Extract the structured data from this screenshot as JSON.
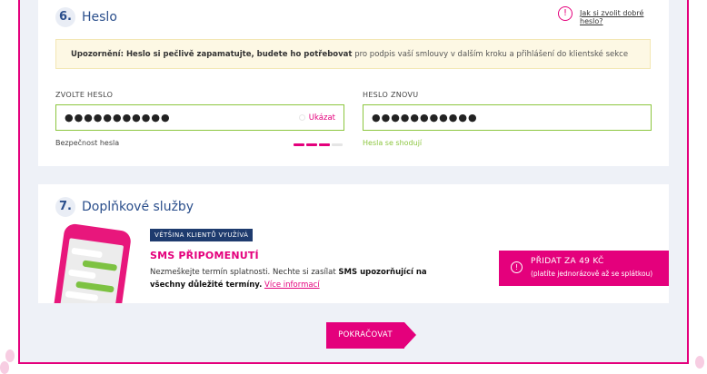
{
  "password_section": {
    "step_number": "6.",
    "title": "Heslo",
    "help_icon": "!",
    "help_link": "Jak si zvolit dobré heslo?",
    "notice_bold": "Upozornění: Heslo si pečlivě zapamatujte, budete ho potřebovat",
    "notice_rest": "pro podpis vaší smlouvy v dalším kroku a přihlášení do klientské sekce",
    "password_label": "ZVOLTE HESLO",
    "password_value": "●●●●●●●●●●●",
    "show_label": "Ukázat",
    "strength_label": "Bezpečnost hesla",
    "strength_level": "3 of 4",
    "repeat_label": "HESLO ZNOVU",
    "repeat_value": "●●●●●●●●●●●",
    "match_text": "Hesla se shodují"
  },
  "services_section": {
    "step_number": "7.",
    "title": "Doplňkové služby",
    "badge": "VĚTŠINA KLIENTŮ VYUŽÍVÁ",
    "service_title": "SMS PŘIPOMENUTÍ",
    "desc_part1": "Nezmeškejte termín splatnosti. Nechte si zasílat",
    "desc_bold1": "SMS upozorňující na všechny důležité termíny.",
    "desc_link": "Více informací",
    "add_button_icon": "!",
    "add_button_title": "PŘIDAT ZA 49 KČ",
    "add_button_note": "(platíte jednorázově až se splátkou)"
  },
  "footer": {
    "continue_label": "POKRAČOVAT"
  },
  "colors": {
    "brand_magenta": "#e4007c",
    "navy": "#2b4f8c",
    "success_green": "#8cc63f"
  }
}
